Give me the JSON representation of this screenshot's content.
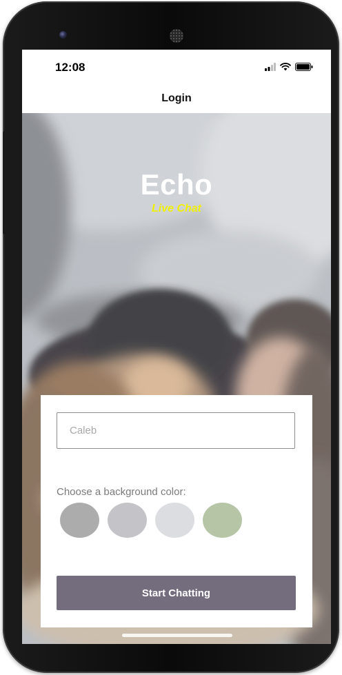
{
  "status_bar": {
    "time": "12:08"
  },
  "nav": {
    "title": "Login"
  },
  "hero": {
    "app_name": "Echo",
    "tagline": "Live Chat"
  },
  "form": {
    "name_placeholder": "Caleb",
    "name_value": "",
    "color_label": "Choose a background color:",
    "colors": [
      "#acacac",
      "#c4c3c8",
      "#dcdde1",
      "#b5c5a5"
    ],
    "start_label": "Start Chatting"
  },
  "theme": {
    "button_color": "#746d7e",
    "tagline_color": "#f0f000"
  },
  "icons": {
    "signal": "signal-icon",
    "wifi": "wifi-icon",
    "battery": "battery-icon"
  }
}
